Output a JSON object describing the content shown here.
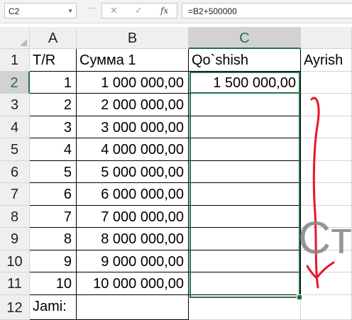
{
  "formula_bar": {
    "name_box": "C2",
    "cancel_icon": "✕",
    "enter_icon": "✓",
    "fx_icon": "fx",
    "formula": "=B2+500000"
  },
  "columns": [
    "A",
    "B",
    "C"
  ],
  "rows": [
    "1",
    "2",
    "3",
    "4",
    "5",
    "6",
    "7",
    "8",
    "9",
    "10",
    "11",
    "12"
  ],
  "header_row": {
    "a": "T/R",
    "b": "Сумма 1",
    "c": "Qo`shish",
    "d": "Ayrish"
  },
  "data": [
    {
      "a": "1",
      "b": "1 000 000,00",
      "c": "1 500 000,00"
    },
    {
      "a": "2",
      "b": "2 000 000,00",
      "c": ""
    },
    {
      "a": "3",
      "b": "3 000 000,00",
      "c": ""
    },
    {
      "a": "4",
      "b": "4 000 000,00",
      "c": ""
    },
    {
      "a": "5",
      "b": "5 000 000,00",
      "c": ""
    },
    {
      "a": "6",
      "b": "6 000 000,00",
      "c": ""
    },
    {
      "a": "7",
      "b": "7 000 000,00",
      "c": ""
    },
    {
      "a": "8",
      "b": "8 000 000,00",
      "c": ""
    },
    {
      "a": "9",
      "b": "9 000 000,00",
      "c": ""
    },
    {
      "a": "10",
      "b": "10 000 000,00",
      "c": ""
    }
  ],
  "footer_row": {
    "a": "Jami:"
  },
  "annotation": {
    "ghost_text": "Ст",
    "arrow_color": "#e8162a"
  },
  "colors": {
    "selection": "#217346"
  }
}
